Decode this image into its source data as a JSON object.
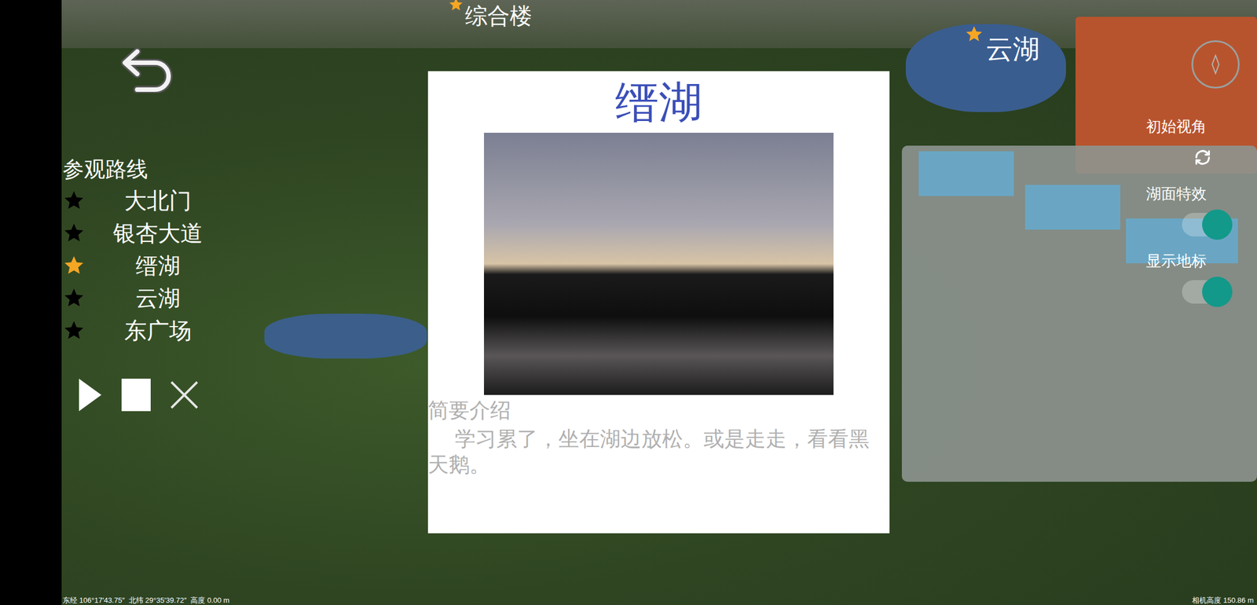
{
  "map": {
    "labels": [
      {
        "text": "综合楼"
      },
      {
        "text": "云湖"
      }
    ]
  },
  "route": {
    "title": "参观路线",
    "items": [
      {
        "label": "大北门",
        "selected": false
      },
      {
        "label": "银杏大道",
        "selected": false
      },
      {
        "label": "缙湖",
        "selected": true
      },
      {
        "label": "云湖",
        "selected": false
      },
      {
        "label": "东广场",
        "selected": false
      }
    ]
  },
  "card": {
    "title": "缙湖",
    "section": "简要介绍",
    "description": "学习累了，坐在湖边放松。或是走走，看看黑天鹅。"
  },
  "settings": [
    {
      "label": "初始视角",
      "kind": "button"
    },
    {
      "label": "湖面特效",
      "kind": "toggle",
      "on": true
    },
    {
      "label": "显示地标",
      "kind": "toggle",
      "on": true
    }
  ],
  "status_bar": {
    "coords": "东经 106°17′43.75″  北纬 29°35′39.72″  高度 0.00 m",
    "camera": "相机高度 150.86 m"
  }
}
